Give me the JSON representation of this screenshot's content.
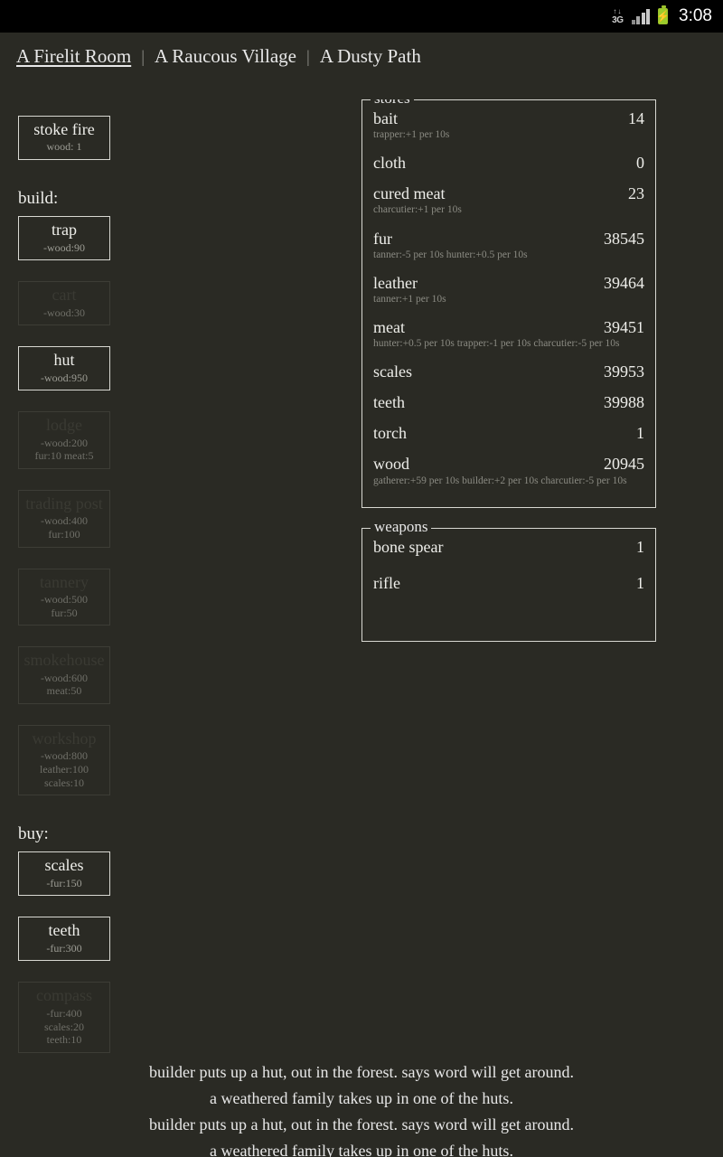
{
  "statusbar": {
    "network_arrows": "↑↓",
    "network_label": "3G",
    "network_icon": "3g-data-icon",
    "signal_icon": "signal-bars-icon",
    "battery_icon": "battery-charging-icon",
    "battery_bolt": "⚡",
    "clock": "3:08",
    "accent_battery": "#9ccc2b"
  },
  "header": {
    "tabs": [
      {
        "label": "A Firelit Room",
        "active": true
      },
      {
        "label": "A Raucous Village",
        "active": false
      },
      {
        "label": "A Dusty Path",
        "active": false
      }
    ],
    "separator": "|"
  },
  "left": {
    "fire_button": {
      "title": "stoke fire",
      "cost": "wood: 1",
      "enabled": true
    },
    "build_label": "build:",
    "build_buttons": [
      {
        "title": "trap",
        "cost": "-wood:90",
        "enabled": true
      },
      {
        "title": "cart",
        "cost": "-wood:30",
        "enabled": false
      },
      {
        "title": "hut",
        "cost": "-wood:950",
        "enabled": true
      },
      {
        "title": "lodge",
        "cost": "-wood:200\nfur:10 meat:5",
        "enabled": false
      },
      {
        "title": "trading post",
        "cost": "-wood:400\nfur:100",
        "enabled": false
      },
      {
        "title": "tannery",
        "cost": "-wood:500\nfur:50",
        "enabled": false
      },
      {
        "title": "smokehouse",
        "cost": "-wood:600\nmeat:50",
        "enabled": false
      },
      {
        "title": "workshop",
        "cost": "-wood:800\nleather:100\nscales:10",
        "enabled": false
      }
    ],
    "buy_label": "buy:",
    "buy_buttons": [
      {
        "title": "scales",
        "cost": "-fur:150",
        "enabled": true
      },
      {
        "title": "teeth",
        "cost": "-fur:300",
        "enabled": true
      },
      {
        "title": "compass",
        "cost": "-fur:400\nscales:20\nteeth:10",
        "enabled": false
      }
    ]
  },
  "stores": {
    "legend": "stores",
    "items": [
      {
        "name": "bait",
        "value": "14",
        "note": "trapper:+1 per 10s"
      },
      {
        "name": "cloth",
        "value": "0",
        "note": ""
      },
      {
        "name": "cured meat",
        "value": "23",
        "note": "charcutier:+1 per 10s"
      },
      {
        "name": "fur",
        "value": "38545",
        "note": "tanner:-5 per 10s hunter:+0.5 per 10s"
      },
      {
        "name": "leather",
        "value": "39464",
        "note": "tanner:+1 per 10s"
      },
      {
        "name": "meat",
        "value": "39451",
        "note": "hunter:+0.5 per 10s trapper:-1 per 10s charcutier:-5 per 10s"
      },
      {
        "name": "scales",
        "value": "39953",
        "note": ""
      },
      {
        "name": "teeth",
        "value": "39988",
        "note": ""
      },
      {
        "name": "torch",
        "value": "1",
        "note": ""
      },
      {
        "name": "wood",
        "value": "20945",
        "note": "gatherer:+59 per 10s builder:+2 per 10s charcutier:-5 per 10s"
      }
    ]
  },
  "weapons": {
    "legend": "weapons",
    "items": [
      {
        "name": "bone spear",
        "value": "1",
        "note": ""
      },
      {
        "name": "rifle",
        "value": "1",
        "note": ""
      }
    ]
  },
  "notifications": {
    "lines": [
      "builder puts up a hut, out in the forest. says word will get around.",
      "a weathered family takes up in one of the huts.",
      "builder puts up a hut, out in the forest. says word will get around.",
      "a weathered family takes up in one of the huts."
    ]
  }
}
